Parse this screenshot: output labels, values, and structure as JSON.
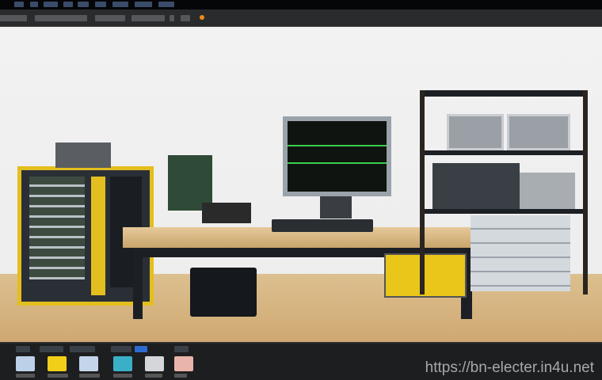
{
  "watermark": "https://bn-electer.in4u.net",
  "colors": {
    "frame_yellow": "#e7c21c",
    "floor": "#d6b582",
    "ui_dark": "#1d1e20",
    "monitor_trace": "#38d048"
  },
  "icons": [
    "image-tile-blue",
    "image-tile-yellow",
    "image-tile-lightblue",
    "image-tile-cyan",
    "image-tile-gray",
    "image-tile-pink"
  ]
}
